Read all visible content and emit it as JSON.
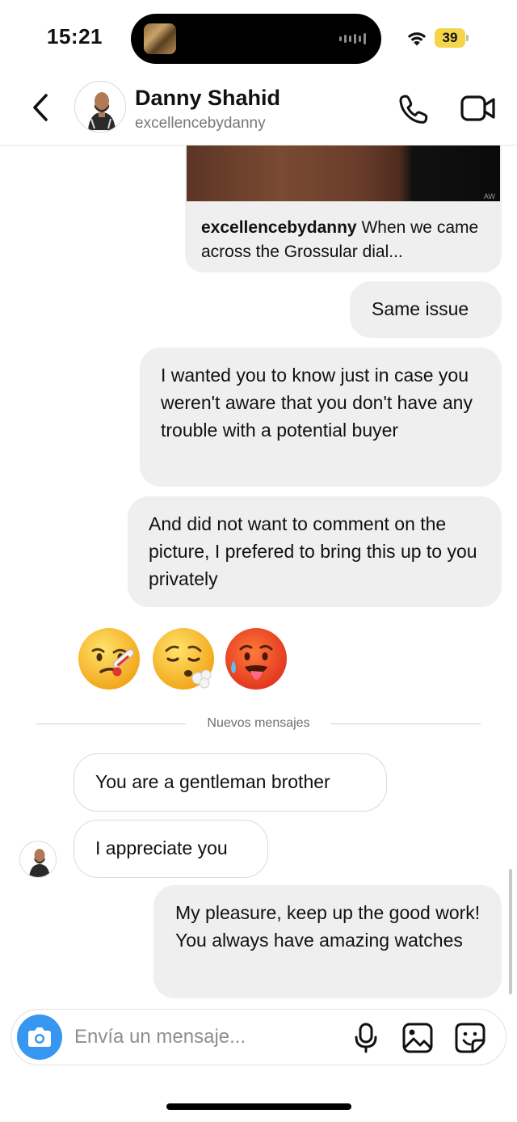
{
  "status_bar": {
    "time": "15:21",
    "battery": "39",
    "icons": [
      "island-thumbnail-icon",
      "audio-wave-icon",
      "wifi-icon",
      "battery-icon"
    ]
  },
  "header": {
    "name": "Danny Shahid",
    "username": "excellencebydanny",
    "icons": [
      "back-chevron-icon",
      "phone-icon",
      "video-camera-icon"
    ]
  },
  "shared_post": {
    "author": "excellencebydanny",
    "caption": " When we came across the Grossular dial..."
  },
  "messages": {
    "m1": "Same issue",
    "m2": "I wanted you to know just in case you weren't aware that you don't have any trouble with a potential buyer",
    "m3": "And did not want to comment on the picture, I prefered to bring this up to you privately",
    "emojis": [
      "🤒",
      "😮‍💨",
      "🥵"
    ],
    "divider": "Nuevos mensajes",
    "r1": "You are a gentleman brother",
    "r2": "I appreciate you",
    "m4": "My pleasure, keep up the good work! You always have amazing watches"
  },
  "composer": {
    "placeholder": "Envía un mensaje...",
    "icons": [
      "camera-icon",
      "microphone-icon",
      "gallery-icon",
      "sticker-icon"
    ]
  },
  "colors": {
    "accent": "#3797f0",
    "outgoing_bubble": "#efefef",
    "incoming_border": "#dbdbdb",
    "battery": "#f4d54a"
  }
}
